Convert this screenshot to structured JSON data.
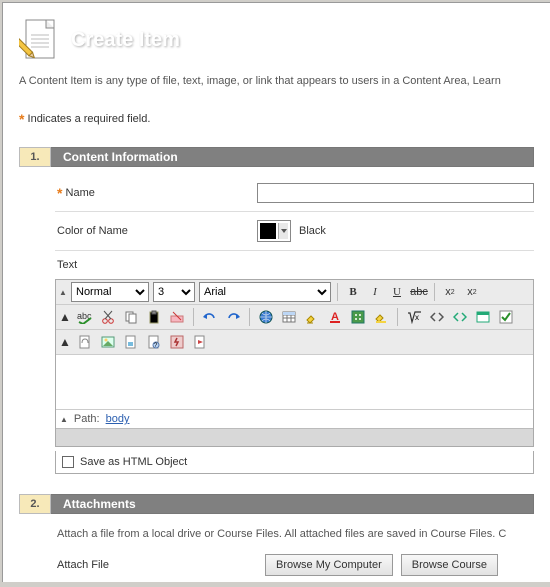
{
  "header": {
    "title": "Create Item",
    "description": "A Content Item is any type of file, text, image, or link that appears to users in a Content Area, Learn"
  },
  "required_note": "Indicates a required field.",
  "sections": {
    "s1": {
      "num": "1.",
      "title": "Content Information"
    },
    "s2": {
      "num": "2.",
      "title": "Attachments"
    }
  },
  "form": {
    "name_label": "Name",
    "name_value": "",
    "color_label": "Color of Name",
    "color_value": "Black",
    "text_label": "Text"
  },
  "editor": {
    "style_options": [
      "Normal"
    ],
    "size_options": [
      "3"
    ],
    "font_options": [
      "Arial"
    ],
    "path_label": "Path:",
    "path_value": "body",
    "save_html_label": "Save as HTML Object"
  },
  "attachments": {
    "desc": "Attach a file from a local drive or Course Files. All attached files are saved in Course Files. C",
    "attach_label": "Attach File",
    "browse_computer": "Browse My Computer",
    "browse_course": "Browse Course"
  }
}
